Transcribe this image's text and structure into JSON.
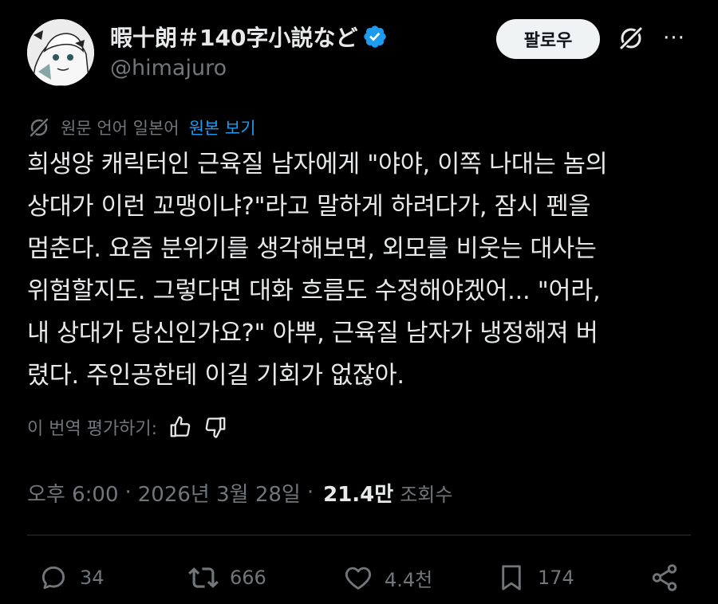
{
  "author": {
    "display_name": "暇十朗＃140字小説など",
    "handle": "@himajuro",
    "avatar_icon": "avatar-illustration-icon",
    "verified_icon": "verified-badge-icon",
    "verified_color": "#1d9bf0"
  },
  "header": {
    "follow_label": "팔로우",
    "grok_icon": "grok-icon",
    "more_label": "···"
  },
  "translation": {
    "source_label": "원문 언어 일본어",
    "show_original_label": "원본 보기",
    "icon": "grok-translate-icon"
  },
  "tweet": {
    "lines": [
      "희생양 캐릭터인 근육질 남자에게 \"야야, 이쪽 나대는 놈의",
      "상대가 이런 꼬맹이냐?\"라고 말하게 하려다가, 잠시 펜을",
      "멈춘다. 요즘 분위기를 생각해보면, 외모를 비웃는 대사는",
      "위험할지도. 그렇다면 대화 흐름도 수정해야겠어... \"어라,",
      "내 상대가 당신인가요?\" 아뿌, 근육질 남자가 냉정해져 버",
      "렸다. 주인공한테 이길 기회가 없잖아."
    ]
  },
  "rating": {
    "label": "이 번역 평가하기:",
    "thumbs_up_icon": "thumbs-up-icon",
    "thumbs_down_icon": "thumbs-down-icon"
  },
  "meta": {
    "time": "오후 6:00",
    "separator": "·",
    "date": "2026년 3월 28일",
    "views_count": "21.4만",
    "views_label": "조회수"
  },
  "actions": {
    "replies": "34",
    "reposts": "666",
    "likes": "4.4천",
    "bookmarks": "174",
    "reply_icon": "reply-icon",
    "repost_icon": "repost-icon",
    "like_icon": "heart-icon",
    "bookmark_icon": "bookmark-icon",
    "share_icon": "share-icon"
  },
  "colors": {
    "background": "#000000",
    "text": "#e7e9ea",
    "secondary": "#71767b",
    "accent": "#1d9bf0",
    "divider": "#2f3336"
  }
}
